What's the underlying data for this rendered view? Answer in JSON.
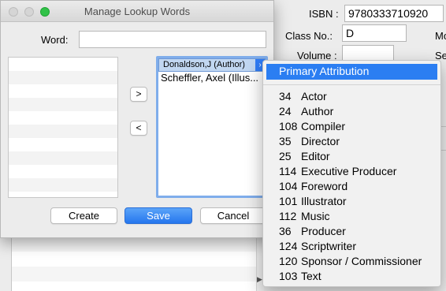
{
  "background_form": {
    "isbn_label": "ISBN :",
    "isbn_value": "9780333710920",
    "classno_label": "Class No.:",
    "classno_value": "D",
    "volume_label": "Volume :",
    "volume_value": "",
    "cut_right_1": "Mo",
    "cut_right_2": "Se"
  },
  "dialog": {
    "title": "Manage Lookup Words",
    "word_label": "Word:",
    "word_value": "",
    "move_right_label": ">",
    "move_left_label": "<",
    "left_list_items": [],
    "right_list_items": [
      "Donaldson,J (Author)",
      "Scheffler, Axel (Illus..."
    ],
    "create_label": "Create",
    "save_label": "Save",
    "cancel_label": "Cancel"
  },
  "popup_menu": {
    "selected": "Primary Attribution",
    "items": [
      {
        "code": "34",
        "label": "Actor"
      },
      {
        "code": "24",
        "label": "Author"
      },
      {
        "code": "108",
        "label": "Compiler"
      },
      {
        "code": "35",
        "label": "Director"
      },
      {
        "code": "25",
        "label": "Editor"
      },
      {
        "code": "114",
        "label": "Executive Producer"
      },
      {
        "code": "104",
        "label": "Foreword"
      },
      {
        "code": "101",
        "label": "Illustrator"
      },
      {
        "code": "112",
        "label": "Music"
      },
      {
        "code": "36",
        "label": "Producer"
      },
      {
        "code": "124",
        "label": "Scriptwriter"
      },
      {
        "code": "120",
        "label": "Sponsor / Commissioner"
      },
      {
        "code": "103",
        "label": "Text"
      }
    ]
  },
  "colors": {
    "accent": "#2b7ef2",
    "selection": "#c1d7f1",
    "zoom_button": "#31c248"
  }
}
